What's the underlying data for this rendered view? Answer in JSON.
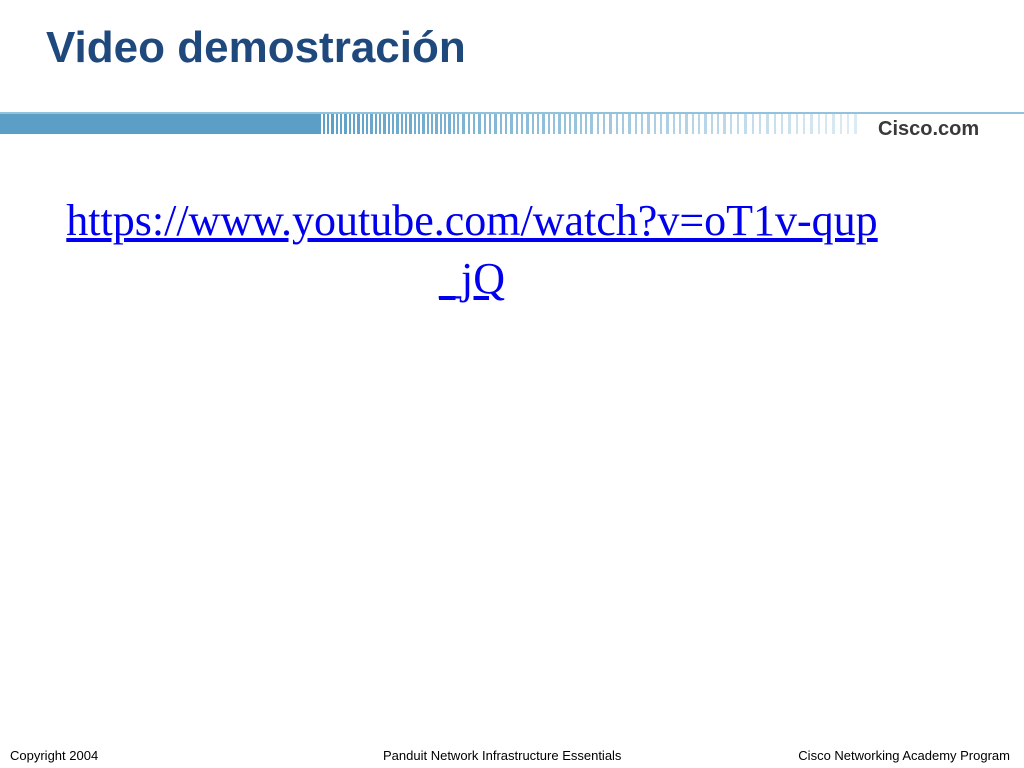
{
  "slide": {
    "title": "Video demostración",
    "link": "https://www.youtube.com/watch?v=oT1v-qup_jQ"
  },
  "header": {
    "logo_text": "Cisco.com",
    "band_color": "#5b9fc7",
    "line_color": "#93c2dd"
  },
  "footer": {
    "left": "Copyright 2004",
    "center": "Panduit Network Infrastructure Essentials",
    "right": "Cisco Networking Academy Program"
  },
  "colors": {
    "title": "#1f497d",
    "link": "#0000ee"
  }
}
